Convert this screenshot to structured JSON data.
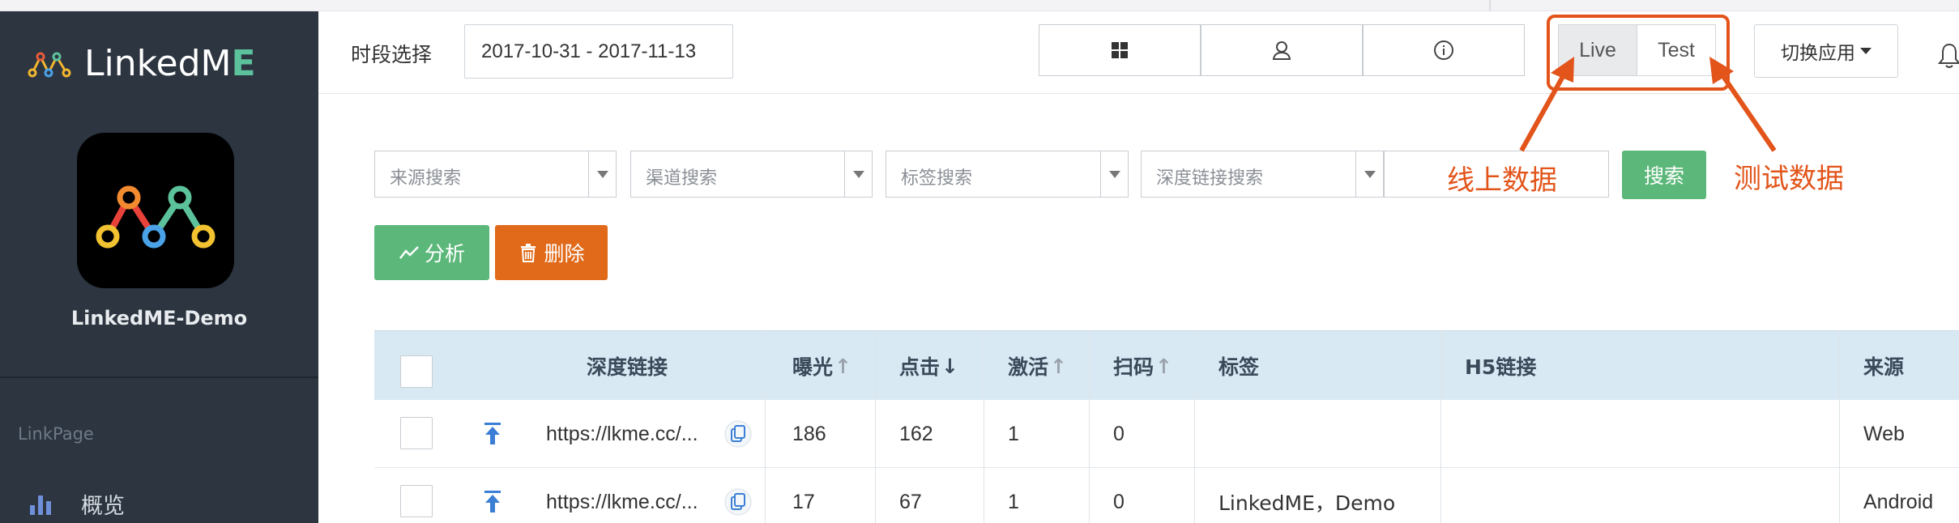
{
  "sidebar": {
    "logo_text_a": "LinkedM",
    "logo_text_b": "E",
    "app_name": "LinkedME-Demo",
    "section_label": "LinkPage",
    "nav_items": [
      {
        "label": "概览",
        "icon": "bar-chart-icon"
      }
    ]
  },
  "header": {
    "period_label": "时段选择",
    "date_range": "2017-10-31 - 2017-11-13",
    "view_icons": [
      "grid-icon",
      "user-icon",
      "info-icon"
    ],
    "env_live": "Live",
    "env_test": "Test",
    "switch_app": "切换应用"
  },
  "filters": {
    "source_placeholder": "来源搜索",
    "channel_placeholder": "渠道搜索",
    "tag_placeholder": "标签搜索",
    "deeplink_placeholder": "深度链接搜索",
    "search_button": "搜索"
  },
  "actions": {
    "analyze": "分析",
    "delete": "删除"
  },
  "annotations": {
    "live_note": "线上数据",
    "test_note": "测试数据",
    "color": "#e2541a"
  },
  "table": {
    "headers": {
      "deeplink": "深度链接",
      "impressions": "曝光",
      "clicks": "点击",
      "activations": "激活",
      "scans": "扫码",
      "tags": "标签",
      "h5": "H5链接",
      "source": "来源"
    },
    "sort_markers": {
      "impressions": "↑",
      "clicks": "↓",
      "activations": "↑",
      "scans": "↑"
    },
    "rows": [
      {
        "link": "https://lkme.cc/...",
        "impressions": "186",
        "clicks": "162",
        "activations": "1",
        "scans": "0",
        "tags": "",
        "h5": "",
        "source": "Web"
      },
      {
        "link": "https://lkme.cc/...",
        "impressions": "17",
        "clicks": "67",
        "activations": "1",
        "scans": "0",
        "tags": "LinkedME，Demo",
        "h5": "",
        "source": "Android"
      }
    ]
  },
  "colors": {
    "sidebar_bg": "#2c3540",
    "accent_green": "#5cb87a",
    "accent_orange": "#e06a1a",
    "table_header_bg": "#d9e9f3"
  }
}
